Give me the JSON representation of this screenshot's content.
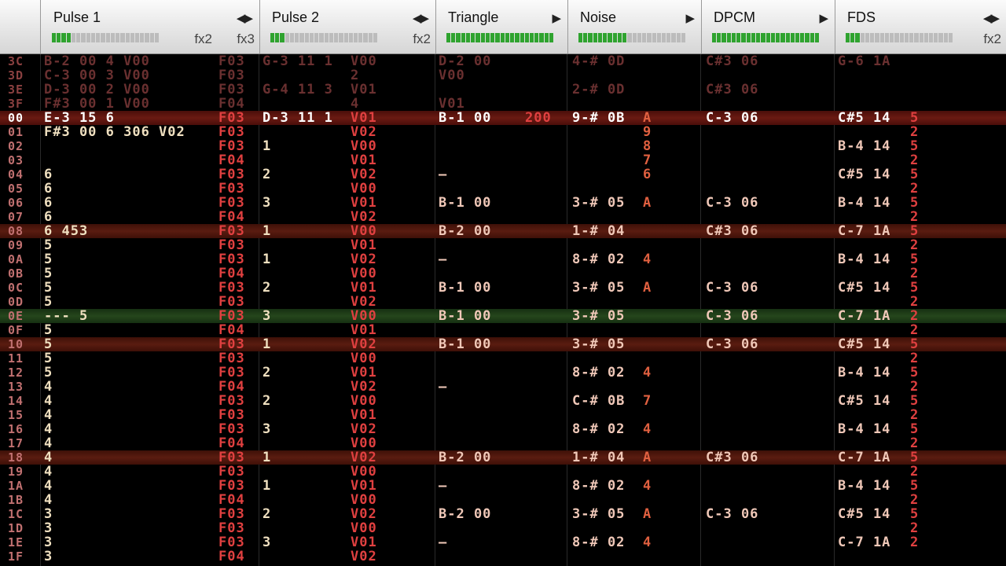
{
  "header": {
    "channels": [
      {
        "name": "Pulse 1",
        "arrows": "◀▶",
        "fx": [
          "fx2",
          "fx3"
        ],
        "meter_level": 0.15
      },
      {
        "name": "Pulse 2",
        "arrows": "◀▶",
        "fx": [
          "fx2"
        ],
        "meter_level": 0.1
      },
      {
        "name": "Triangle",
        "arrows": "▶",
        "fx": [],
        "meter_level": 1.0
      },
      {
        "name": "Noise",
        "arrows": "▶",
        "fx": [],
        "meter_level": 0.45
      },
      {
        "name": "DPCM",
        "arrows": "▶",
        "fx": [],
        "meter_level": 1.0
      },
      {
        "name": "FDS",
        "arrows": "◀▶",
        "fx": [
          "fx2"
        ],
        "meter_level": 0.1
      }
    ]
  },
  "rows": [
    {
      "n": "3C",
      "style": "dim",
      "cells": [
        "B-2 00 4 V00",
        "F03",
        "G-3 11 1",
        "V00",
        "D-2 00",
        "",
        "4-# 0D",
        "",
        "C#3 06",
        "",
        "G-6 1A",
        ""
      ]
    },
    {
      "n": "3D",
      "style": "dim",
      "cells": [
        "C-3 00 3 V00",
        "F03",
        "",
        "2",
        "V00",
        "",
        "",
        "",
        "",
        "",
        "",
        ""
      ]
    },
    {
      "n": "3E",
      "style": "dim",
      "cells": [
        "D-3 00 2 V00",
        "F03",
        "G-4 11 3",
        "V01",
        "",
        "",
        "2-# 0D",
        "",
        "C#3 06",
        "",
        "",
        ""
      ]
    },
    {
      "n": "3F",
      "style": "dim",
      "cells": [
        "F#3 00 1 V00",
        "F04",
        "",
        "4",
        "V01",
        "",
        "",
        "",
        "",
        "",
        "",
        ""
      ]
    },
    {
      "n": "00",
      "style": "cursor",
      "cells": [
        "E-3 15 6",
        "F03",
        "D-3 11 1",
        "V01",
        "B-1 00",
        "200",
        "9-# 0B",
        "A",
        "C-3 06",
        "",
        "C#5 14",
        "5"
      ]
    },
    {
      "n": "01",
      "cells": [
        "F#3 00 6 306 V02",
        "F03",
        "",
        "V02",
        "",
        "",
        "",
        "9",
        "",
        "",
        "",
        "2"
      ]
    },
    {
      "n": "02",
      "cells": [
        "",
        "F03",
        "1",
        "V00",
        "",
        "",
        "",
        "8",
        "",
        "",
        "B-4 14",
        "5"
      ]
    },
    {
      "n": "03",
      "cells": [
        "",
        "F04",
        "",
        "V01",
        "",
        "",
        "",
        "7",
        "",
        "",
        "",
        "2"
      ]
    },
    {
      "n": "04",
      "cells": [
        "6",
        "F03",
        "2",
        "V02",
        "—",
        "",
        "",
        "6",
        "",
        "",
        "C#5 14",
        "5"
      ]
    },
    {
      "n": "05",
      "cells": [
        "6",
        "F03",
        "",
        "V00",
        "",
        "",
        "",
        "",
        "",
        "",
        "",
        "2"
      ]
    },
    {
      "n": "06",
      "cells": [
        "6",
        "F03",
        "3",
        "V01",
        "B-1 00",
        "",
        "3-# 05",
        "A",
        "C-3 06",
        "",
        "B-4 14",
        "5"
      ]
    },
    {
      "n": "07",
      "cells": [
        "6",
        "F04",
        "",
        "V02",
        "",
        "",
        "",
        "",
        "",
        "",
        "",
        "2"
      ]
    },
    {
      "n": "08",
      "style": "red",
      "cells": [
        "6 453",
        "F03",
        "1",
        "V00",
        "B-2 00",
        "",
        "1-# 04",
        "",
        "C#3 06",
        "",
        "C-7 1A",
        "5"
      ]
    },
    {
      "n": "09",
      "cells": [
        "5",
        "F03",
        "",
        "V01",
        "",
        "",
        "",
        "",
        "",
        "",
        "",
        "2"
      ]
    },
    {
      "n": "0A",
      "cells": [
        "5",
        "F03",
        "1",
        "V02",
        "—",
        "",
        "8-# 02",
        "4",
        "",
        "",
        "B-4 14",
        "5"
      ]
    },
    {
      "n": "0B",
      "cells": [
        "5",
        "F04",
        "",
        "V00",
        "",
        "",
        "",
        "",
        "",
        "",
        "",
        "2"
      ]
    },
    {
      "n": "0C",
      "cells": [
        "5",
        "F03",
        "2",
        "V01",
        "B-1 00",
        "",
        "3-# 05",
        "A",
        "C-3 06",
        "",
        "C#5 14",
        "5"
      ]
    },
    {
      "n": "0D",
      "cells": [
        "5",
        "F03",
        "",
        "V02",
        "",
        "",
        "",
        "",
        "",
        "",
        "",
        "2"
      ]
    },
    {
      "n": "0E",
      "style": "green",
      "cells": [
        "--- 5",
        "F03",
        "3",
        "V00",
        "B-1 00",
        "",
        "3-# 05",
        "",
        "C-3 06",
        "",
        "C-7 1A",
        "2"
      ]
    },
    {
      "n": "0F",
      "cells": [
        "5",
        "F04",
        "",
        "V01",
        "",
        "",
        "",
        "",
        "",
        "",
        "",
        "2"
      ]
    },
    {
      "n": "10",
      "style": "red",
      "cells": [
        "5",
        "F03",
        "1",
        "V02",
        "B-1 00",
        "",
        "3-# 05",
        "",
        "C-3 06",
        "",
        "C#5 14",
        "5"
      ]
    },
    {
      "n": "11",
      "cells": [
        "5",
        "F03",
        "",
        "V00",
        "",
        "",
        "",
        "",
        "",
        "",
        "",
        "2"
      ]
    },
    {
      "n": "12",
      "cells": [
        "5",
        "F03",
        "2",
        "V01",
        "",
        "",
        "8-# 02",
        "4",
        "",
        "",
        "B-4 14",
        "5"
      ]
    },
    {
      "n": "13",
      "cells": [
        "4",
        "F04",
        "",
        "V02",
        "—",
        "",
        "",
        "",
        "",
        "",
        "",
        "2"
      ]
    },
    {
      "n": "14",
      "cells": [
        "4",
        "F03",
        "2",
        "V00",
        "",
        "",
        "C-# 0B",
        "7",
        "",
        "",
        "C#5 14",
        "5"
      ]
    },
    {
      "n": "15",
      "cells": [
        "4",
        "F03",
        "",
        "V01",
        "",
        "",
        "",
        "",
        "",
        "",
        "",
        "2"
      ]
    },
    {
      "n": "16",
      "cells": [
        "4",
        "F03",
        "3",
        "V02",
        "",
        "",
        "8-# 02",
        "4",
        "",
        "",
        "B-4 14",
        "5"
      ]
    },
    {
      "n": "17",
      "cells": [
        "4",
        "F04",
        "",
        "V00",
        "",
        "",
        "",
        "",
        "",
        "",
        "",
        "2"
      ]
    },
    {
      "n": "18",
      "style": "red",
      "cells": [
        "4",
        "F03",
        "1",
        "V02",
        "B-2 00",
        "",
        "1-# 04",
        "A",
        "C#3 06",
        "",
        "C-7 1A",
        "5"
      ]
    },
    {
      "n": "19",
      "cells": [
        "4",
        "F03",
        "",
        "V00",
        "",
        "",
        "",
        "",
        "",
        "",
        "",
        "2"
      ]
    },
    {
      "n": "1A",
      "cells": [
        "4",
        "F03",
        "1",
        "V01",
        "—",
        "",
        "8-# 02",
        "4",
        "",
        "",
        "B-4 14",
        "5"
      ]
    },
    {
      "n": "1B",
      "cells": [
        "4",
        "F04",
        "",
        "V00",
        "",
        "",
        "",
        "",
        "",
        "",
        "",
        "2"
      ]
    },
    {
      "n": "1C",
      "cells": [
        "3",
        "F03",
        "2",
        "V02",
        "B-2 00",
        "",
        "3-# 05",
        "A",
        "C-3 06",
        "",
        "C#5 14",
        "5"
      ]
    },
    {
      "n": "1D",
      "cells": [
        "3",
        "F03",
        "",
        "V00",
        "",
        "",
        "",
        "",
        "",
        "",
        "",
        "2"
      ]
    },
    {
      "n": "1E",
      "cells": [
        "3",
        "F03",
        "3",
        "V01",
        "—",
        "",
        "8-# 02",
        "4",
        "",
        "",
        "C-7 1A",
        "2"
      ]
    },
    {
      "n": "1F",
      "cells": [
        "3",
        "F04",
        "",
        "V02",
        "",
        "",
        "",
        "",
        "",
        "",
        "",
        ""
      ]
    }
  ],
  "colors": {
    "note": "#f0e0c0",
    "instr": "#e04040",
    "volume": "#e04040",
    "effect": "#e05050",
    "dot": "#3c3c3c"
  }
}
